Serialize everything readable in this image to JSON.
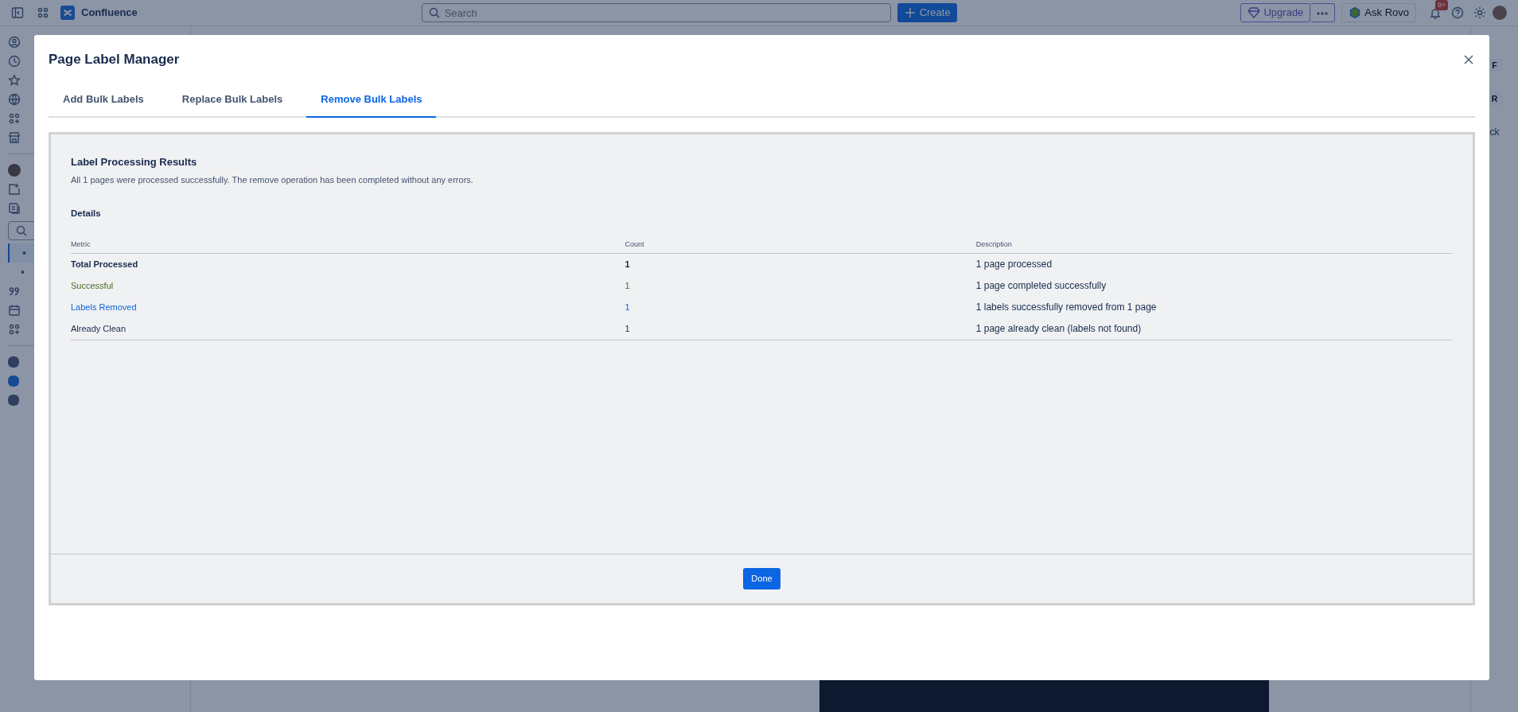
{
  "topbar": {
    "app_name": "Confluence",
    "search": {
      "placeholder": "Search"
    },
    "create_button": "Create",
    "upgrade_button": "Upgrade",
    "ask_button": "Ask Rovo",
    "notification_badge": "9+"
  },
  "sidebar": {
    "tree_items": [
      {
        "label": "•",
        "selected": true
      },
      {
        "label": "•",
        "selected": false
      }
    ]
  },
  "right_rail": {
    "keys": [
      "F",
      "R"
    ],
    "snippet": "ck"
  },
  "modal": {
    "title": "Page Label Manager",
    "tabs": [
      {
        "label": "Add Bulk Labels",
        "selected": false
      },
      {
        "label": "Replace Bulk Labels",
        "selected": false
      },
      {
        "label": "Remove Bulk Labels",
        "selected": true
      }
    ],
    "results": {
      "title": "Label Processing Results",
      "message": "All 1 pages were processed successfully. The remove operation has been completed without any errors.",
      "details_title": "Details",
      "table": {
        "columns": [
          "Metric",
          "Count",
          "Description"
        ],
        "rows": [
          {
            "metric": "Total Processed",
            "count": "1",
            "description": "1 page processed",
            "color": "#172b4d",
            "emphasis": true
          },
          {
            "metric": "Successful",
            "count": "1",
            "description": "1 page completed successfully",
            "color": "#4c6b1f",
            "emphasis": false
          },
          {
            "metric": "Labels Removed",
            "count": "1",
            "description": "1 labels successfully removed from 1 page",
            "color": "#0c66e4",
            "emphasis": false
          },
          {
            "metric": "Already Clean",
            "count": "1",
            "description": "1 page already clean (labels not found)",
            "color": "#172b4d",
            "emphasis": false
          }
        ]
      }
    },
    "done_button": "Done"
  }
}
